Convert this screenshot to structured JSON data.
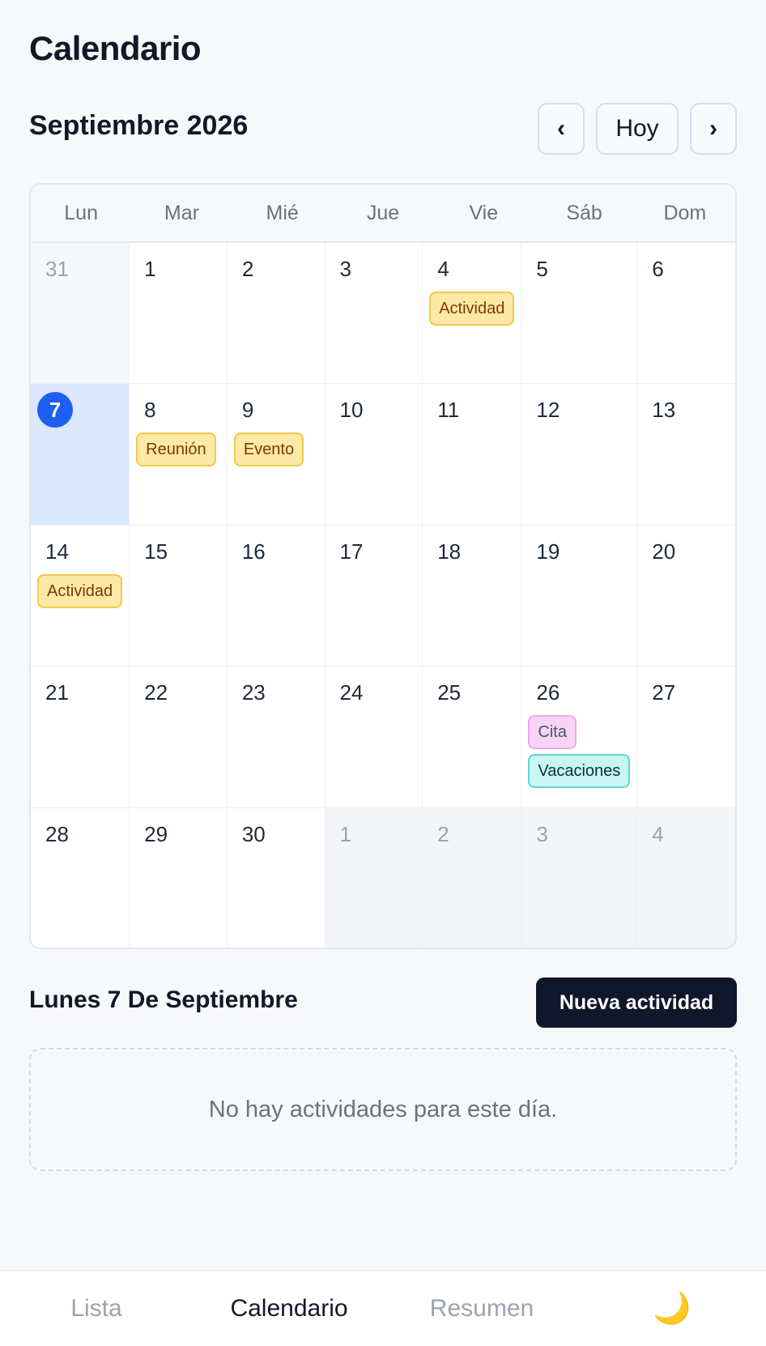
{
  "page": {
    "title": "Calendario"
  },
  "header": {
    "month_label": "Septiembre 2026",
    "prev": "‹",
    "today": "Hoy",
    "next": "›"
  },
  "weekdays": [
    "Lun",
    "Mar",
    "Mié",
    "Jue",
    "Vie",
    "Sáb",
    "Dom"
  ],
  "days": [
    {
      "n": "31",
      "other": true
    },
    {
      "n": "1"
    },
    {
      "n": "2"
    },
    {
      "n": "3"
    },
    {
      "n": "4",
      "events": [
        {
          "label": "Actividad",
          "color": "yellow"
        }
      ]
    },
    {
      "n": "5"
    },
    {
      "n": "6"
    },
    {
      "n": "7",
      "selected": true,
      "today": true
    },
    {
      "n": "8",
      "events": [
        {
          "label": "Reunión",
          "color": "yellow"
        }
      ]
    },
    {
      "n": "9",
      "events": [
        {
          "label": "Evento",
          "color": "yellow"
        }
      ]
    },
    {
      "n": "10"
    },
    {
      "n": "11"
    },
    {
      "n": "12"
    },
    {
      "n": "13"
    },
    {
      "n": "14",
      "events": [
        {
          "label": "Actividad",
          "color": "yellow"
        }
      ]
    },
    {
      "n": "15"
    },
    {
      "n": "16"
    },
    {
      "n": "17"
    },
    {
      "n": "18"
    },
    {
      "n": "19"
    },
    {
      "n": "20"
    },
    {
      "n": "21"
    },
    {
      "n": "22"
    },
    {
      "n": "23"
    },
    {
      "n": "24"
    },
    {
      "n": "25"
    },
    {
      "n": "26",
      "events": [
        {
          "label": "Cita",
          "color": "pink"
        },
        {
          "label": "Vacaciones",
          "color": "teal"
        }
      ]
    },
    {
      "n": "27"
    },
    {
      "n": "28"
    },
    {
      "n": "29"
    },
    {
      "n": "30"
    },
    {
      "n": "1",
      "other": true
    },
    {
      "n": "2",
      "other": true
    },
    {
      "n": "3",
      "other": true
    },
    {
      "n": "4",
      "other": true
    }
  ],
  "selected_day": {
    "title": "Lunes 7 De Septiembre",
    "new_button": "Nueva actividad",
    "empty_text": "No hay actividades para este día."
  },
  "bottom_nav": {
    "items": [
      "Lista",
      "Calendario",
      "Resumen"
    ],
    "active": "Calendario",
    "theme_icon": "🌙"
  },
  "colors": {
    "accent": "#1d5ff2",
    "selected_bg": "#dbe8fd",
    "event_yellow": "#fde9a6",
    "event_pink": "#f8d3f4",
    "event_teal": "#c9f5f3",
    "primary_button": "#0f172a"
  }
}
